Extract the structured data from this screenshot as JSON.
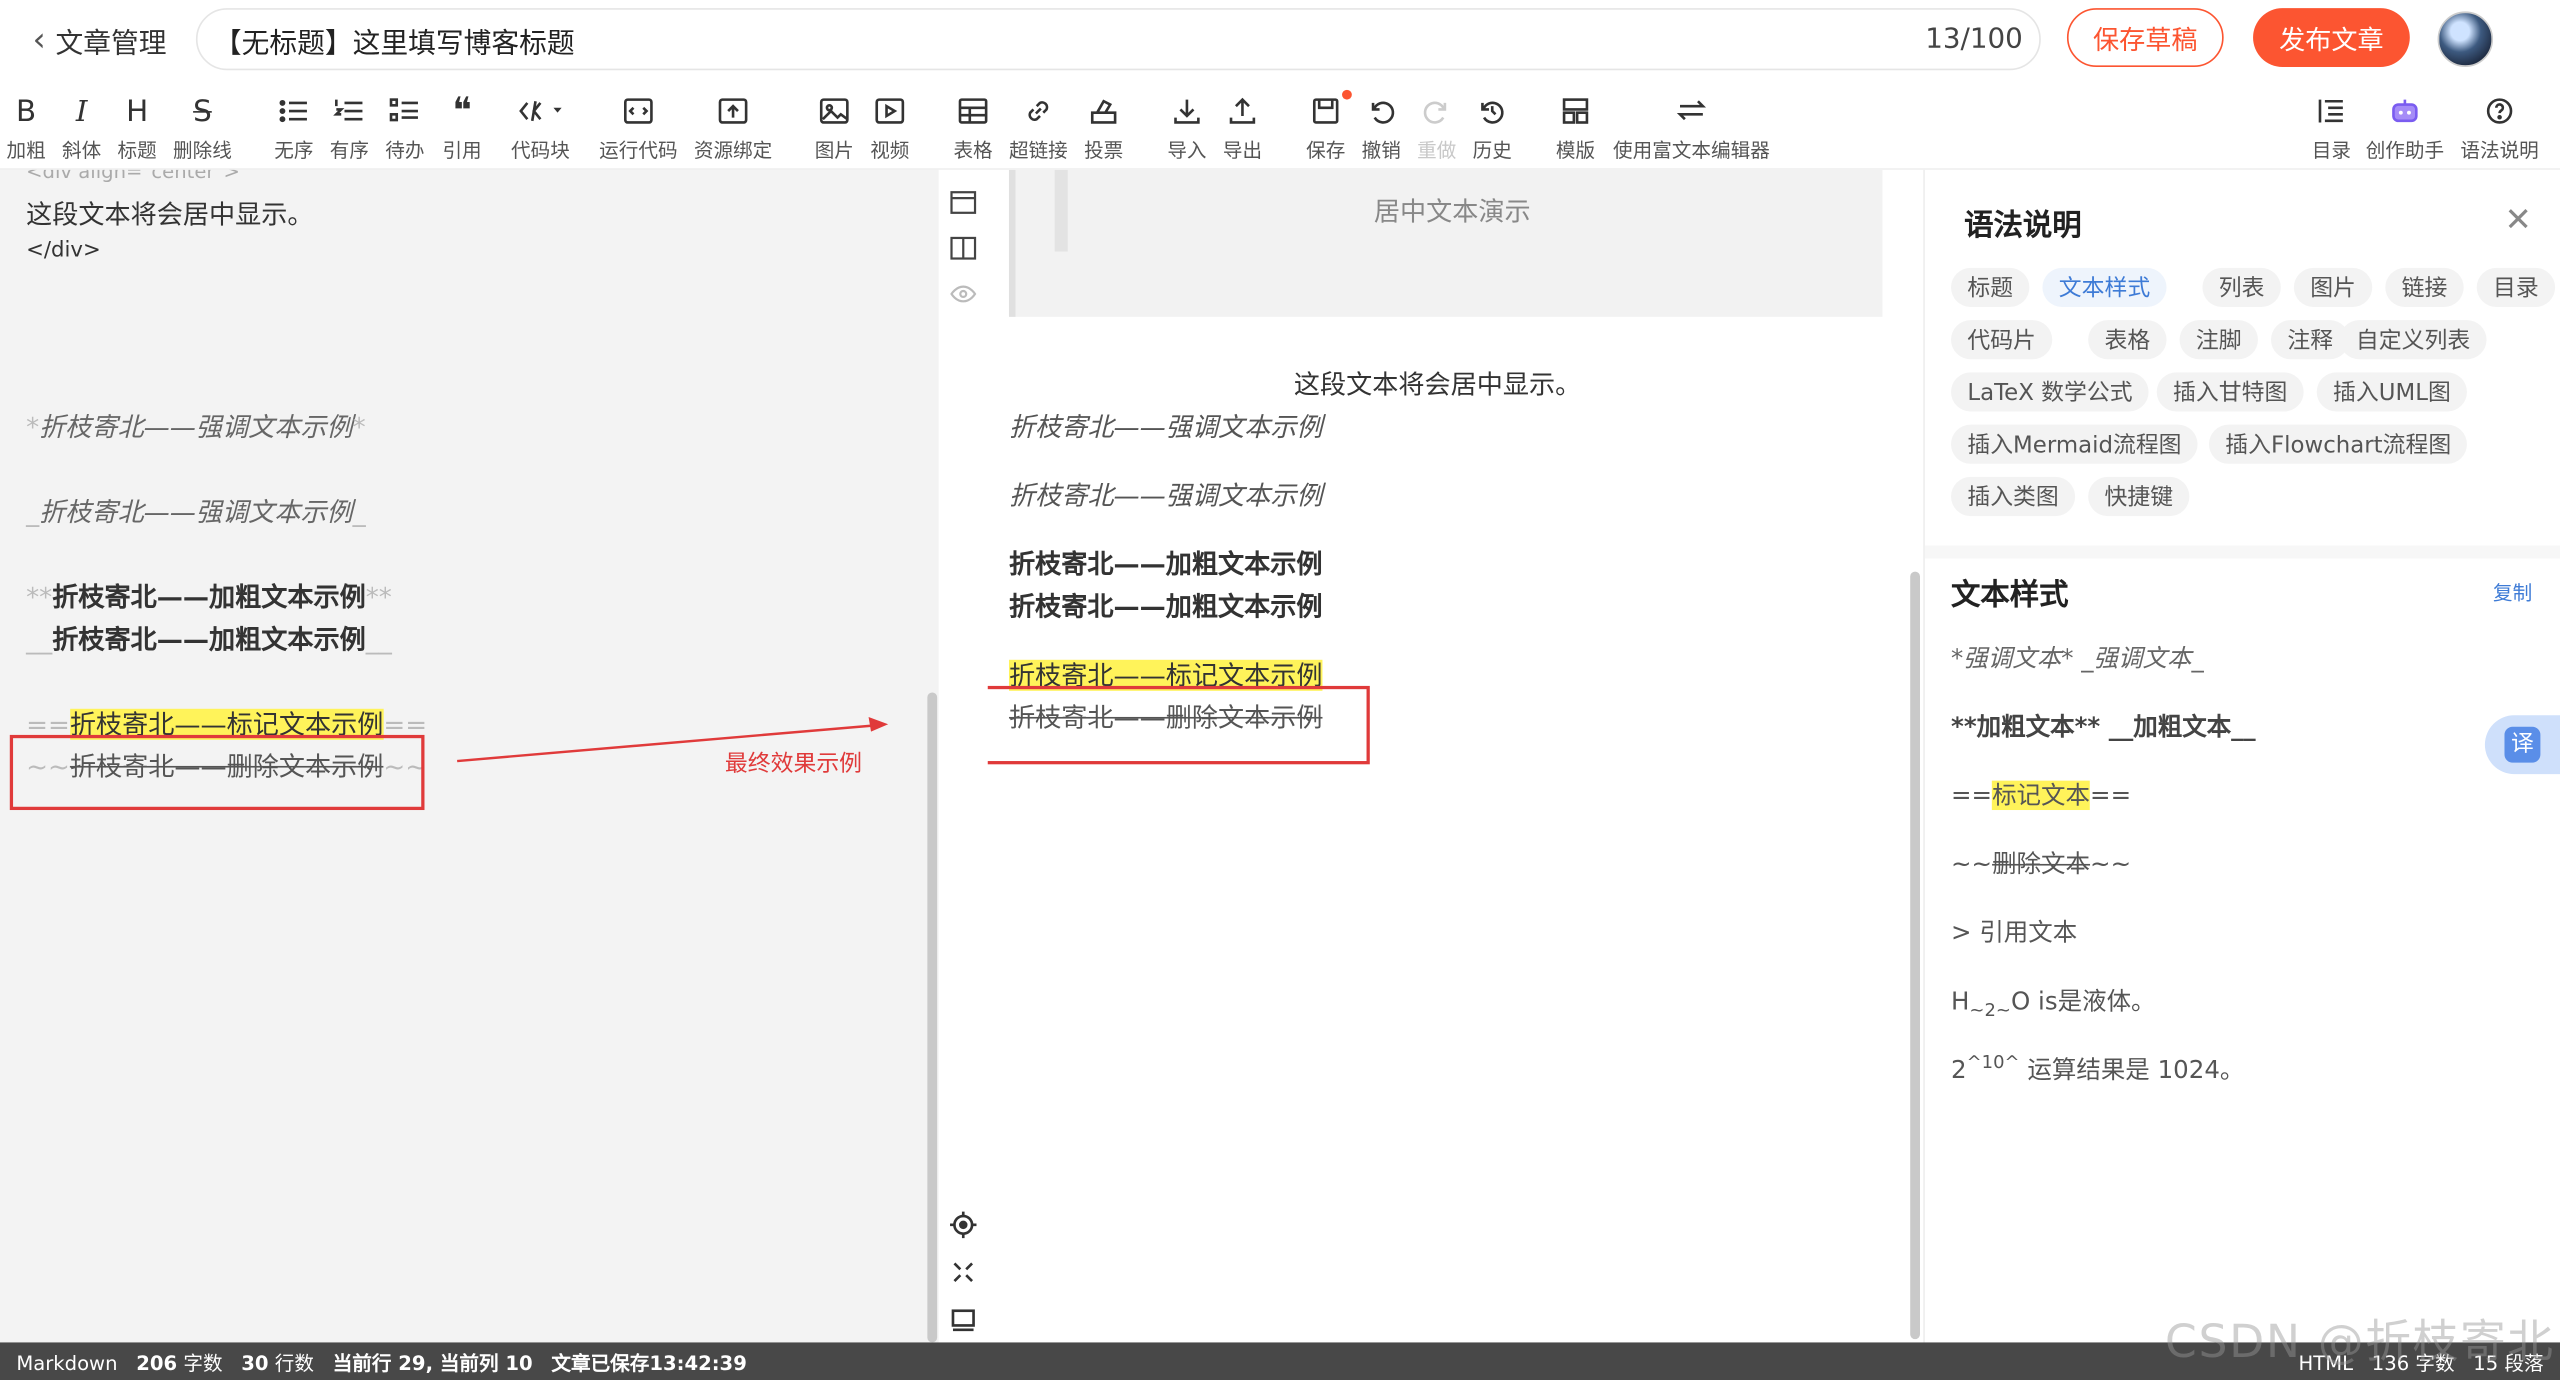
{
  "header": {
    "back_label": "文章管理",
    "title_value": "【无标题】这里填写博客标题",
    "title_count": "13/100",
    "save_draft": "保存草稿",
    "publish": "发布文章"
  },
  "toolbar": {
    "bold": {
      "icon": "B",
      "label": "加粗"
    },
    "italic": {
      "icon": "I",
      "label": "斜体"
    },
    "heading": {
      "icon": "H",
      "label": "标题"
    },
    "strike": {
      "icon": "S",
      "label": "删除线"
    },
    "ul": {
      "label": "无序"
    },
    "ol": {
      "label": "有序"
    },
    "todo": {
      "label": "待办"
    },
    "quote": {
      "icon": "❝",
      "label": "引用"
    },
    "codeblock": {
      "label": "代码块"
    },
    "runcode": {
      "label": "运行代码"
    },
    "resource": {
      "label": "资源绑定"
    },
    "image": {
      "label": "图片"
    },
    "video": {
      "label": "视频"
    },
    "table": {
      "label": "表格"
    },
    "link": {
      "label": "超链接"
    },
    "vote": {
      "label": "投票"
    },
    "import": {
      "label": "导入"
    },
    "export": {
      "label": "导出"
    },
    "save": {
      "label": "保存"
    },
    "undo": {
      "label": "撤销"
    },
    "redo": {
      "label": "重做"
    },
    "history": {
      "label": "历史"
    },
    "template": {
      "label": "模版"
    },
    "richtext": {
      "label": "使用富文本编辑器"
    },
    "toc": {
      "label": "目录"
    },
    "assistant": {
      "label": "创作助手"
    },
    "syntax": {
      "label": "语法说明"
    }
  },
  "editor": {
    "line_center_text": "这段文本将会居中显示。",
    "line_div_close": "</div>",
    "em1_mark": "*",
    "em1_text": "折枝寄北——强调文本示例",
    "em2_mark": "_",
    "em2_text": "折枝寄北——强调文本示例",
    "bold1_mark": "**",
    "bold1_text": "折枝寄北——加粗文本示例",
    "bold2_mark": "__",
    "bold2_text": "折枝寄北——加粗文本示例",
    "mark_mark": "==",
    "mark_text": "折枝寄北——标记文本示例",
    "del_mark": "~~",
    "del_text": "折枝寄北——删除文本示例",
    "annotation": "最终效果示例"
  },
  "preview": {
    "quote_text": "居中文本演示",
    "center_text": "这段文本将会居中显示。",
    "em1": "折枝寄北——强调文本示例",
    "em2": "折枝寄北——强调文本示例",
    "bold1": "折枝寄北——加粗文本示例",
    "bold2": "折枝寄北——加粗文本示例",
    "mark": "折枝寄北——标记文本示例",
    "del": "折枝寄北——删除文本示例"
  },
  "syntax_panel": {
    "title": "语法说明",
    "tags": [
      "标题",
      "文本样式",
      "列表",
      "图片",
      "链接",
      "目录",
      "代码片",
      "表格",
      "注脚",
      "注释",
      "自定义列表",
      "LaTeX 数学公式",
      "插入甘特图",
      "插入UML图",
      "插入Mermaid流程图",
      "插入Flowchart流程图",
      "插入类图",
      "快捷键"
    ],
    "active_tag": "文本样式",
    "section_title": "文本样式",
    "copy_label": "复制",
    "lines": {
      "emphasis": "*强调文本* _强调文本_",
      "bold": "**加粗文本** __加粗文本__",
      "mark_pre": "==",
      "mark_text": "标记文本",
      "mark_post": "==",
      "del_pre": "~~",
      "del_text": "删除文本",
      "del_post": "~~",
      "quote": "> 引用文本",
      "sub_a": "H",
      "sub_b": "~2~",
      "sub_c": "O is是液体。",
      "sup_a": "2",
      "sup_b": "^10^",
      "sup_c": " 运算结果是 1024。"
    },
    "translate_label": "译"
  },
  "statusbar": {
    "mode": "Markdown",
    "chars_num": "206",
    "chars_label": "字数",
    "lines_num": "30",
    "lines_label": "行数",
    "cursor": "当前行 29, 当前列 10",
    "saved": "文章已保存13:42:39",
    "right_mode": "HTML",
    "right_chars": "136 字数",
    "right_paras": "15 段落"
  },
  "watermark": "CSDN @折枝寄北",
  "colors": {
    "accent": "#fc5531",
    "link": "#3e7bd6",
    "highlight": "#fff35a",
    "annotation": "#e03a3a"
  }
}
